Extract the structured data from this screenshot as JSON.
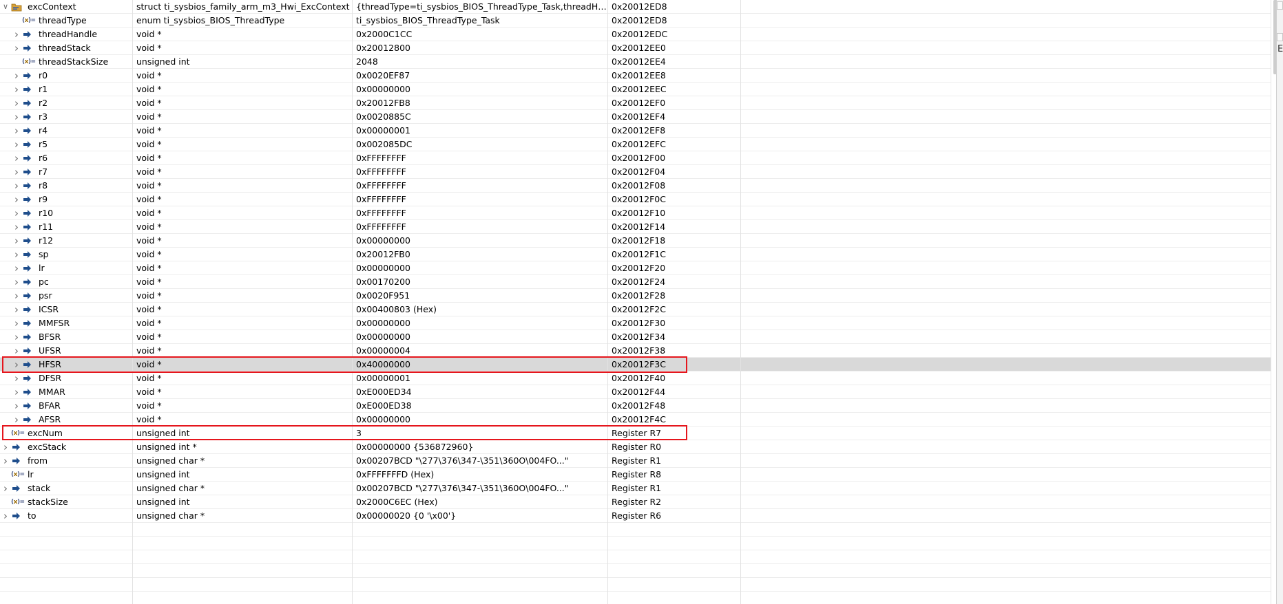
{
  "accent_colors": {
    "highlight_border": "#e5161d",
    "selected_row": "#d9d9d9",
    "pointer_icon": "#1f4e8c",
    "struct_icon": "#d8a23a"
  },
  "rows": [
    {
      "name": "excContext",
      "type": "struct ti_sysbios_family_arm_m3_Hwi_ExcContext",
      "value": "{threadType=ti_sysbios_BIOS_ThreadType_Task,threadHandl...",
      "location": "0x20012ED8",
      "depth": 0,
      "chevron": "chevron-down",
      "icon": "struct-icon"
    },
    {
      "name": "threadType",
      "type": "enum ti_sysbios_BIOS_ThreadType",
      "value": "ti_sysbios_BIOS_ThreadType_Task",
      "location": "0x20012ED8",
      "depth": 1,
      "chevron": "",
      "icon": "variable-icon"
    },
    {
      "name": "threadHandle",
      "type": "void *",
      "value": "0x2000C1CC",
      "location": "0x20012EDC",
      "depth": 1,
      "chevron": "chevron-right",
      "icon": "pointer-icon"
    },
    {
      "name": "threadStack",
      "type": "void *",
      "value": "0x20012800",
      "location": "0x20012EE0",
      "depth": 1,
      "chevron": "chevron-right",
      "icon": "pointer-icon"
    },
    {
      "name": "threadStackSize",
      "type": "unsigned int",
      "value": "2048",
      "location": "0x20012EE4",
      "depth": 1,
      "chevron": "",
      "icon": "variable-icon"
    },
    {
      "name": "r0",
      "type": "void *",
      "value": "0x0020EF87",
      "location": "0x20012EE8",
      "depth": 1,
      "chevron": "chevron-right",
      "icon": "pointer-icon"
    },
    {
      "name": "r1",
      "type": "void *",
      "value": "0x00000000",
      "location": "0x20012EEC",
      "depth": 1,
      "chevron": "chevron-right",
      "icon": "pointer-icon"
    },
    {
      "name": "r2",
      "type": "void *",
      "value": "0x20012FB8",
      "location": "0x20012EF0",
      "depth": 1,
      "chevron": "chevron-right",
      "icon": "pointer-icon"
    },
    {
      "name": "r3",
      "type": "void *",
      "value": "0x0020885C",
      "location": "0x20012EF4",
      "depth": 1,
      "chevron": "chevron-right",
      "icon": "pointer-icon"
    },
    {
      "name": "r4",
      "type": "void *",
      "value": "0x00000001",
      "location": "0x20012EF8",
      "depth": 1,
      "chevron": "chevron-right",
      "icon": "pointer-icon"
    },
    {
      "name": "r5",
      "type": "void *",
      "value": "0x002085DC",
      "location": "0x20012EFC",
      "depth": 1,
      "chevron": "chevron-right",
      "icon": "pointer-icon"
    },
    {
      "name": "r6",
      "type": "void *",
      "value": "0xFFFFFFFF",
      "location": "0x20012F00",
      "depth": 1,
      "chevron": "chevron-right",
      "icon": "pointer-icon"
    },
    {
      "name": "r7",
      "type": "void *",
      "value": "0xFFFFFFFF",
      "location": "0x20012F04",
      "depth": 1,
      "chevron": "chevron-right",
      "icon": "pointer-icon"
    },
    {
      "name": "r8",
      "type": "void *",
      "value": "0xFFFFFFFF",
      "location": "0x20012F08",
      "depth": 1,
      "chevron": "chevron-right",
      "icon": "pointer-icon"
    },
    {
      "name": "r9",
      "type": "void *",
      "value": "0xFFFFFFFF",
      "location": "0x20012F0C",
      "depth": 1,
      "chevron": "chevron-right",
      "icon": "pointer-icon"
    },
    {
      "name": "r10",
      "type": "void *",
      "value": "0xFFFFFFFF",
      "location": "0x20012F10",
      "depth": 1,
      "chevron": "chevron-right",
      "icon": "pointer-icon"
    },
    {
      "name": "r11",
      "type": "void *",
      "value": "0xFFFFFFFF",
      "location": "0x20012F14",
      "depth": 1,
      "chevron": "chevron-right",
      "icon": "pointer-icon"
    },
    {
      "name": "r12",
      "type": "void *",
      "value": "0x00000000",
      "location": "0x20012F18",
      "depth": 1,
      "chevron": "chevron-right",
      "icon": "pointer-icon"
    },
    {
      "name": "sp",
      "type": "void *",
      "value": "0x20012FB0",
      "location": "0x20012F1C",
      "depth": 1,
      "chevron": "chevron-right",
      "icon": "pointer-icon"
    },
    {
      "name": "lr",
      "type": "void *",
      "value": "0x00000000",
      "location": "0x20012F20",
      "depth": 1,
      "chevron": "chevron-right",
      "icon": "pointer-icon"
    },
    {
      "name": "pc",
      "type": "void *",
      "value": "0x00170200",
      "location": "0x20012F24",
      "depth": 1,
      "chevron": "chevron-right",
      "icon": "pointer-icon"
    },
    {
      "name": "psr",
      "type": "void *",
      "value": "0x0020F951",
      "location": "0x20012F28",
      "depth": 1,
      "chevron": "chevron-right",
      "icon": "pointer-icon"
    },
    {
      "name": "ICSR",
      "type": "void *",
      "value": "0x00400803 (Hex)",
      "location": "0x20012F2C",
      "depth": 1,
      "chevron": "chevron-right",
      "icon": "pointer-icon"
    },
    {
      "name": "MMFSR",
      "type": "void *",
      "value": "0x00000000",
      "location": "0x20012F30",
      "depth": 1,
      "chevron": "chevron-right",
      "icon": "pointer-icon"
    },
    {
      "name": "BFSR",
      "type": "void *",
      "value": "0x00000000",
      "location": "0x20012F34",
      "depth": 1,
      "chevron": "chevron-right",
      "icon": "pointer-icon"
    },
    {
      "name": "UFSR",
      "type": "void *",
      "value": "0x00000004",
      "location": "0x20012F38",
      "depth": 1,
      "chevron": "chevron-right",
      "icon": "pointer-icon"
    },
    {
      "name": "HFSR",
      "type": "void *",
      "value": "0x40000000",
      "location": "0x20012F3C",
      "depth": 1,
      "chevron": "chevron-right",
      "icon": "pointer-icon",
      "selected": true,
      "highlighted": true
    },
    {
      "name": "DFSR",
      "type": "void *",
      "value": "0x00000001",
      "location": "0x20012F40",
      "depth": 1,
      "chevron": "chevron-right",
      "icon": "pointer-icon"
    },
    {
      "name": "MMAR",
      "type": "void *",
      "value": "0xE000ED34",
      "location": "0x20012F44",
      "depth": 1,
      "chevron": "chevron-right",
      "icon": "pointer-icon"
    },
    {
      "name": "BFAR",
      "type": "void *",
      "value": "0xE000ED38",
      "location": "0x20012F48",
      "depth": 1,
      "chevron": "chevron-right",
      "icon": "pointer-icon"
    },
    {
      "name": "AFSR",
      "type": "void *",
      "value": "0x00000000",
      "location": "0x20012F4C",
      "depth": 1,
      "chevron": "chevron-right",
      "icon": "pointer-icon"
    },
    {
      "name": "excNum",
      "type": "unsigned int",
      "value": "3",
      "location": "Register R7",
      "depth": 0,
      "chevron": "",
      "icon": "variable-icon",
      "highlighted": true
    },
    {
      "name": "excStack",
      "type": "unsigned int *",
      "value": "0x00000000 {536872960}",
      "location": "Register R0",
      "depth": 0,
      "chevron": "chevron-right",
      "icon": "pointer-icon"
    },
    {
      "name": "from",
      "type": "unsigned char *",
      "value": "0x00207BCD \"\\277\\376\\347-\\351\\360O\\004FO...\"",
      "location": "Register R1",
      "depth": 0,
      "chevron": "chevron-right",
      "icon": "pointer-icon"
    },
    {
      "name": "lr",
      "type": "unsigned int",
      "value": "0xFFFFFFFD (Hex)",
      "location": "Register R8",
      "depth": 0,
      "chevron": "",
      "icon": "variable-icon"
    },
    {
      "name": "stack",
      "type": "unsigned char *",
      "value": "0x00207BCD \"\\277\\376\\347-\\351\\360O\\004FO...\"",
      "location": "Register R1",
      "depth": 0,
      "chevron": "chevron-right",
      "icon": "pointer-icon"
    },
    {
      "name": "stackSize",
      "type": "unsigned int",
      "value": "0x2000C6EC (Hex)",
      "location": "Register R2",
      "depth": 0,
      "chevron": "",
      "icon": "variable-icon"
    },
    {
      "name": "to",
      "type": "unsigned char *",
      "value": "0x00000020 {0 '\\x00'}",
      "location": "Register R6",
      "depth": 0,
      "chevron": "chevron-right",
      "icon": "pointer-icon"
    },
    {
      "name": "",
      "type": "",
      "value": "",
      "location": "",
      "depth": 0,
      "chevron": "",
      "icon": ""
    },
    {
      "name": "",
      "type": "",
      "value": "",
      "location": "",
      "depth": 0,
      "chevron": "",
      "icon": ""
    },
    {
      "name": "",
      "type": "",
      "value": "",
      "location": "",
      "depth": 0,
      "chevron": "",
      "icon": ""
    },
    {
      "name": "",
      "type": "",
      "value": "",
      "location": "",
      "depth": 0,
      "chevron": "",
      "icon": ""
    },
    {
      "name": "",
      "type": "",
      "value": "",
      "location": "",
      "depth": 0,
      "chevron": "",
      "icon": ""
    },
    {
      "name": "",
      "type": "",
      "value": "",
      "location": "",
      "depth": 0,
      "chevron": "",
      "icon": ""
    }
  ],
  "side_panel": {
    "glyph": "E"
  }
}
